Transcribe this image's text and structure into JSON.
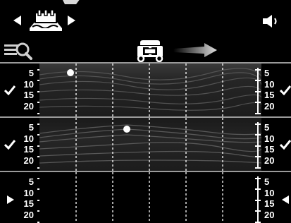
{
  "header": {
    "nav_prev_icon": "triangle-left-icon",
    "nav_next_icon": "triangle-right-icon",
    "tool_icon": "foundation-scan-icon",
    "volume_icon": "speaker-icon"
  },
  "toolbar": {
    "zoom_icon": "magnifier-icon",
    "cart_icon": "scanner-cart-icon",
    "direction_icon": "arrow-right-icon"
  },
  "scans": [
    {
      "depth_ticks": [
        "5",
        "10",
        "15",
        "20"
      ],
      "left_marker": "check-icon",
      "right_marker": "check-icon",
      "target_dot_icon": "white-dot-icon"
    },
    {
      "depth_ticks": [
        "5",
        "10",
        "15",
        "20"
      ],
      "left_marker": "check-icon",
      "right_marker": "check-icon",
      "target_dot_icon": "white-dot-icon"
    },
    {
      "depth_ticks": [
        "5",
        "10",
        "15",
        "20"
      ],
      "left_marker": "play-right-icon",
      "right_marker": "play-left-icon"
    }
  ],
  "colors": {
    "background": "#000000",
    "foreground": "#ffffff",
    "grid": "#ffffff"
  }
}
